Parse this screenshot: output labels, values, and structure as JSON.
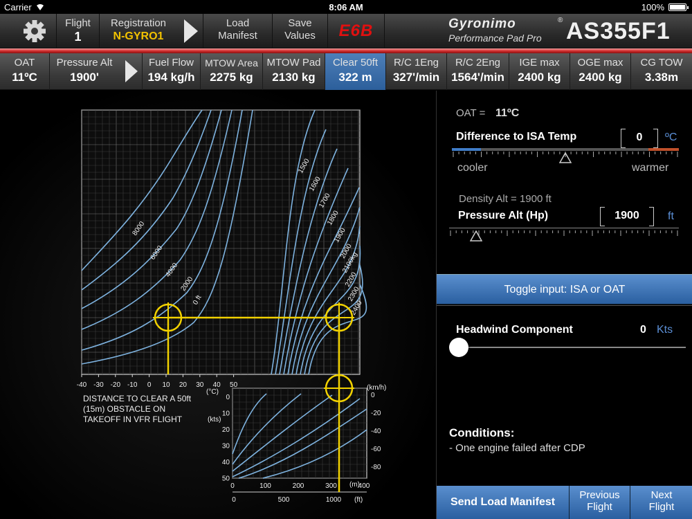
{
  "status": {
    "carrier": "Carrier",
    "time": "8:06 AM",
    "battery": "100%"
  },
  "toolbar": {
    "flight_label": "Flight",
    "flight_value": "1",
    "registration_label": "Registration",
    "registration_value": "N-GYRO1",
    "load_manifest_l1": "Load",
    "load_manifest_l2": "Manifest",
    "save_values_l1": "Save",
    "save_values_l2": "Values",
    "e6b": "E6B",
    "brand": "Gyronimo",
    "brand_sub": "Performance Pad Pro",
    "model": "AS355F1",
    "registration_color": "#f2c200"
  },
  "params": [
    {
      "label": "OAT",
      "value": "11ºC"
    },
    {
      "label": "Pressure Alt",
      "value": "1900'"
    },
    {
      "label": "Fuel Flow",
      "value": "194 kg/h"
    },
    {
      "label": "MTOW Area",
      "value": "2275 kg"
    },
    {
      "label": "MTOW Pad",
      "value": "2130 kg"
    },
    {
      "label": "Clear 50ft",
      "value": "322 m",
      "active": true
    },
    {
      "label": "R/C 1Eng",
      "value": "327'/min"
    },
    {
      "label": "R/C 2Eng",
      "value": "1564'/min"
    },
    {
      "label": "IGE max",
      "value": "2400 kg"
    },
    {
      "label": "OGE max",
      "value": "2400 kg"
    },
    {
      "label": "CG TOW",
      "value": "3.38m"
    }
  ],
  "chart_data": {
    "type": "line",
    "title": "",
    "caption": [
      "DISTANCE TO CLEAR A 50ft",
      "(15m) OBSTACLE ON",
      "TAKEOFF IN VFR FLIGHT"
    ],
    "temp_axis": {
      "unit": "(°C)",
      "ticks": [
        "-40",
        "-30",
        "-20",
        "-10",
        "0",
        "10",
        "20",
        "30",
        "40",
        "50"
      ]
    },
    "altitude_curves": [
      "8000",
      "6000",
      "4000",
      "2000",
      "0 ft"
    ],
    "weight_curves": [
      "1500",
      "1600",
      "1700",
      "1800",
      "1900",
      "2000",
      "2100kg",
      "2200",
      "2300",
      "2400"
    ],
    "wind_axis_kts": {
      "unit": "(kts)",
      "ticks": [
        "0",
        "10",
        "20",
        "30",
        "40",
        "50"
      ]
    },
    "wind_axis_kmh": {
      "unit": "(km/h)",
      "ticks": [
        "0",
        "20",
        "40",
        "60",
        "80"
      ]
    },
    "distance_axis_m": {
      "unit": "(m)",
      "ticks": [
        "0",
        "100",
        "200",
        "300",
        "400"
      ]
    },
    "distance_axis_ft": {
      "unit": "(ft)",
      "ticks": [
        "0",
        "500",
        "1000"
      ]
    },
    "result_distance_m": 322,
    "input_temp_c": 11,
    "line_color": "#7eb3e0",
    "marker_color": "#f2d200"
  },
  "right": {
    "oat_label": "OAT =",
    "oat_value": "11ºC",
    "isa_diff_label": "Difference to ISA Temp",
    "isa_diff_value": "0",
    "isa_diff_unit": "ºC",
    "cooler": "cooler",
    "warmer": "warmer",
    "density_alt": "Density Alt = 1900 ft",
    "pressure_alt_label": "Pressure Alt (Hp)",
    "pressure_alt_value": "1900",
    "pressure_alt_unit": "ft",
    "toggle_label": "Toggle input: ISA or OAT",
    "headwind_label": "Headwind Component",
    "headwind_value": "0",
    "headwind_unit": "Kts",
    "conditions_title": "Conditions:",
    "conditions_text": "- One engine failed after CDP",
    "send_manifest": "Send Load Manifest",
    "prev_l1": "Previous",
    "prev_l2": "Flight",
    "next_l1": "Next",
    "next_l2": "Flight"
  }
}
